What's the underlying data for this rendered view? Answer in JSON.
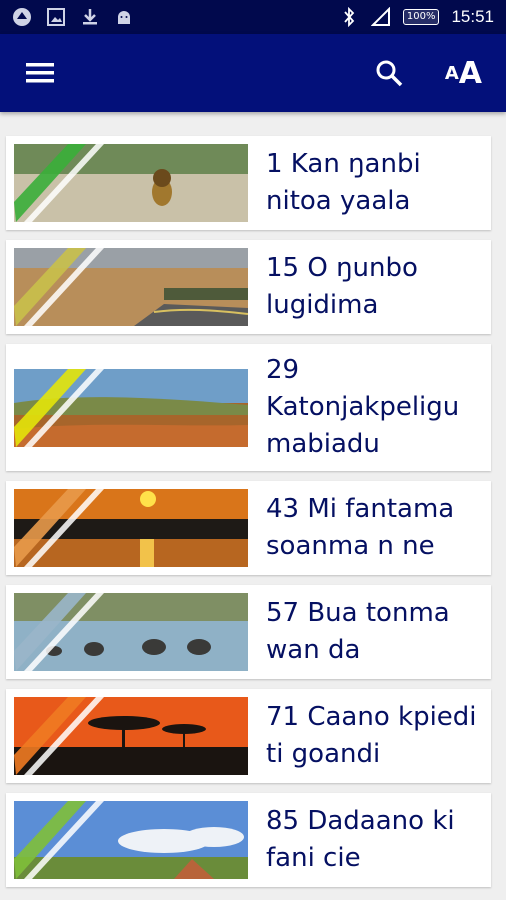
{
  "status_bar": {
    "battery": "100%",
    "time": "15:51",
    "left_icons": [
      "app-icon",
      "image-icon",
      "download-icon",
      "android-icon"
    ],
    "right_icons": [
      "bluetooth-icon",
      "signal-icon",
      "battery-icon"
    ]
  },
  "app_bar": {
    "menu_icon": "hamburger-menu-icon",
    "search_icon": "search-icon",
    "font_size_label_small": "A",
    "font_size_label_big": "A"
  },
  "items": [
    {
      "title": "1 Kan ŋanbi nitoa yaala",
      "scene": "lion",
      "stripe_color": "#3aae3a"
    },
    {
      "title": "15 O ŋunbo lugidima",
      "scene": "road",
      "stripe_color": "#c9c04a"
    },
    {
      "title": "29 Katonjakpeligu mabiadu",
      "scene": "hills",
      "stripe_color": "#e3e40a"
    },
    {
      "title": "43 Mi fantama soanma n ne",
      "scene": "sunset-river",
      "stripe_color": "#e89a4a"
    },
    {
      "title": "57 Bua tonma wan da",
      "scene": "elephants",
      "stripe_color": "#9ab6c9"
    },
    {
      "title": "71 Caano kpiedi ti goandi",
      "scene": "acacia-sunset",
      "stripe_color": "#f07a22"
    },
    {
      "title": "85 Dadaano ki fani cie",
      "scene": "savanna-sky",
      "stripe_color": "#7fbf3a"
    }
  ]
}
